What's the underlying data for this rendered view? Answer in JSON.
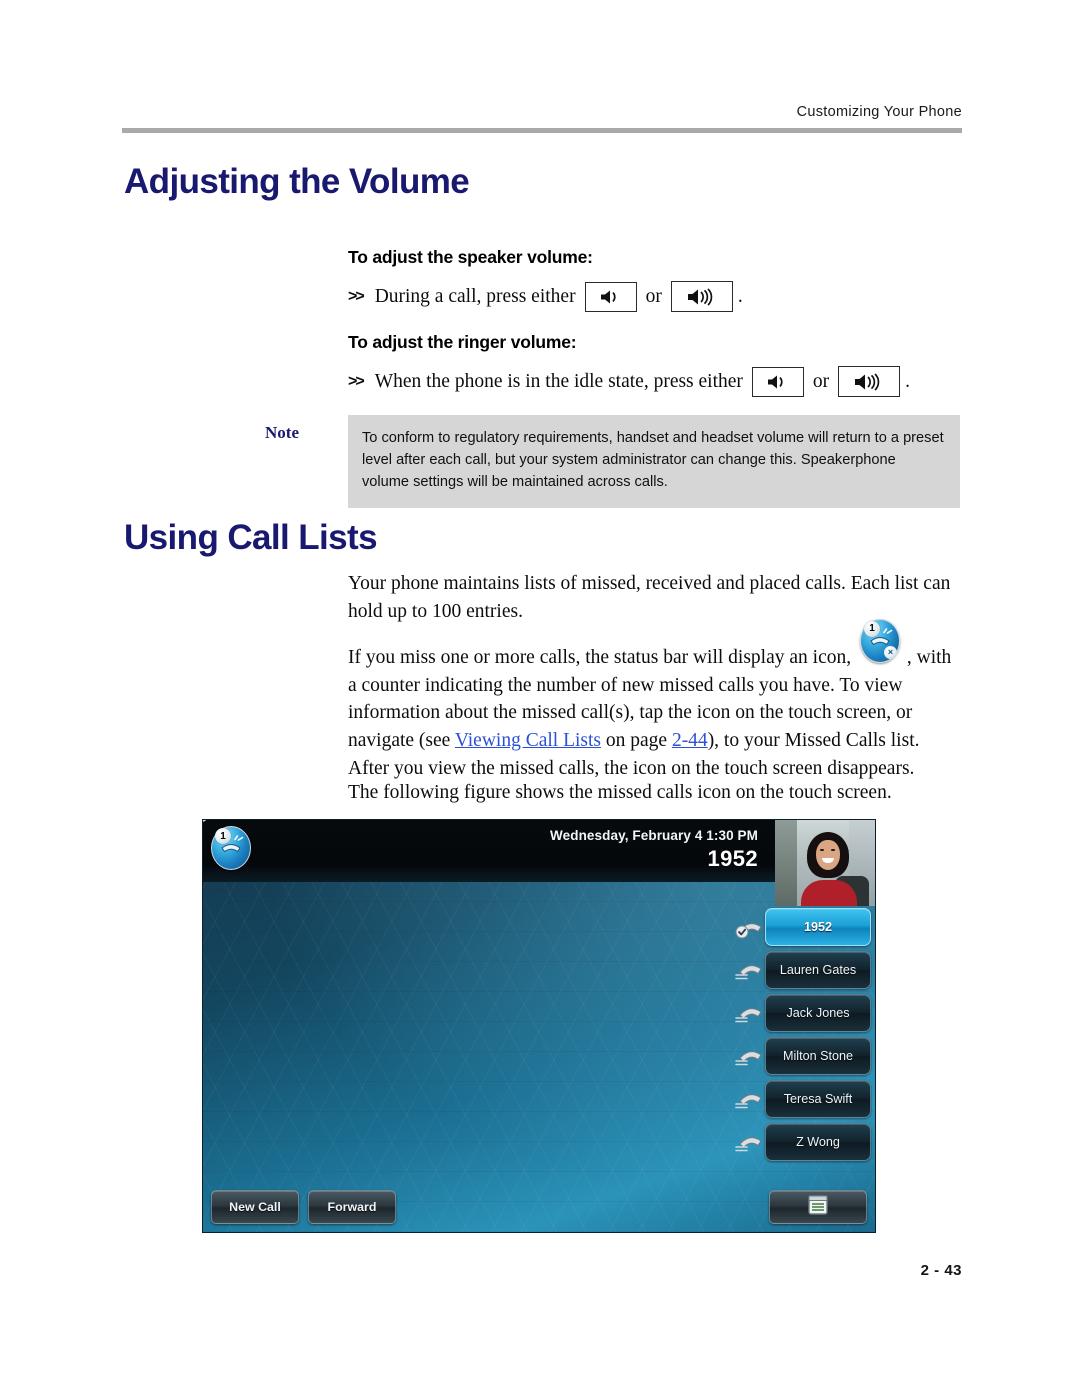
{
  "header": {
    "running_head": "Customizing Your Phone"
  },
  "sections": {
    "volume": {
      "heading": "Adjusting the Volume",
      "speaker": {
        "sub_heading": "To adjust the speaker volume:",
        "bullet": ">>",
        "text": "During a call, press either",
        "or": "or",
        "period": ".",
        "key_down_icon": "volume-down-icon",
        "key_up_icon": "volume-up-icon"
      },
      "ringer": {
        "sub_heading": "To adjust the ringer volume:",
        "bullet": ">>",
        "text": "When the phone is in the idle state, press either",
        "or": "or",
        "period": ".",
        "key_down_icon": "volume-down-icon",
        "key_up_icon": "volume-up-icon"
      },
      "note": {
        "label": "Note",
        "body": "To conform to regulatory requirements, handset and headset volume will return to a preset level after each call, but your system administrator can change this. Speakerphone volume settings will be maintained across calls."
      }
    },
    "call_lists": {
      "heading": "Using Call Lists",
      "paragraph_1": "Your phone maintains lists of missed, received and placed calls. Each list can hold up to 100 entries.",
      "paragraph_2": {
        "before_icon": "If you miss one or more calls, the status bar will display an icon,",
        "icon": "missed-calls-icon",
        "after_icon": ", with a counter indicating the number of new missed calls you have. To view information about the missed call(s), tap the icon on the touch screen, or navigate (see ",
        "link_text": "Viewing Call Lists",
        "mid_text": " on page ",
        "link_page": "2-44",
        "tail_text": "), to your Missed Calls list. After you view the missed calls, the icon on the touch screen disappears."
      },
      "paragraph_3": "The following figure shows the missed calls icon on the touch screen."
    }
  },
  "phone_figure": {
    "status_bar": {
      "missed_icon": "missed-calls-icon",
      "missed_count": "1",
      "datetime": "Wednesday, February 4  1:30 PM",
      "extension": "1952"
    },
    "contact_photo_alt": "contact-photo",
    "line_keys": [
      {
        "label": "1952",
        "active": true
      },
      {
        "label": "Lauren Gates",
        "active": false
      },
      {
        "label": "Jack Jones",
        "active": false
      },
      {
        "label": "Milton Stone",
        "active": false
      },
      {
        "label": "Teresa Swift",
        "active": false
      },
      {
        "label": "Z Wong",
        "active": false
      }
    ],
    "soft_keys": [
      {
        "label": "New Call"
      },
      {
        "label": "Forward"
      }
    ],
    "menu_key_icon": "menu-list-icon"
  },
  "footer": {
    "page_number": "2 - 43"
  },
  "colors": {
    "heading_blue": "#191970",
    "link_blue": "#2b4fd6",
    "note_background": "#d6d6d6",
    "rule_gray": "#a9a9a9",
    "active_key_blue": "#1b9fd6"
  }
}
